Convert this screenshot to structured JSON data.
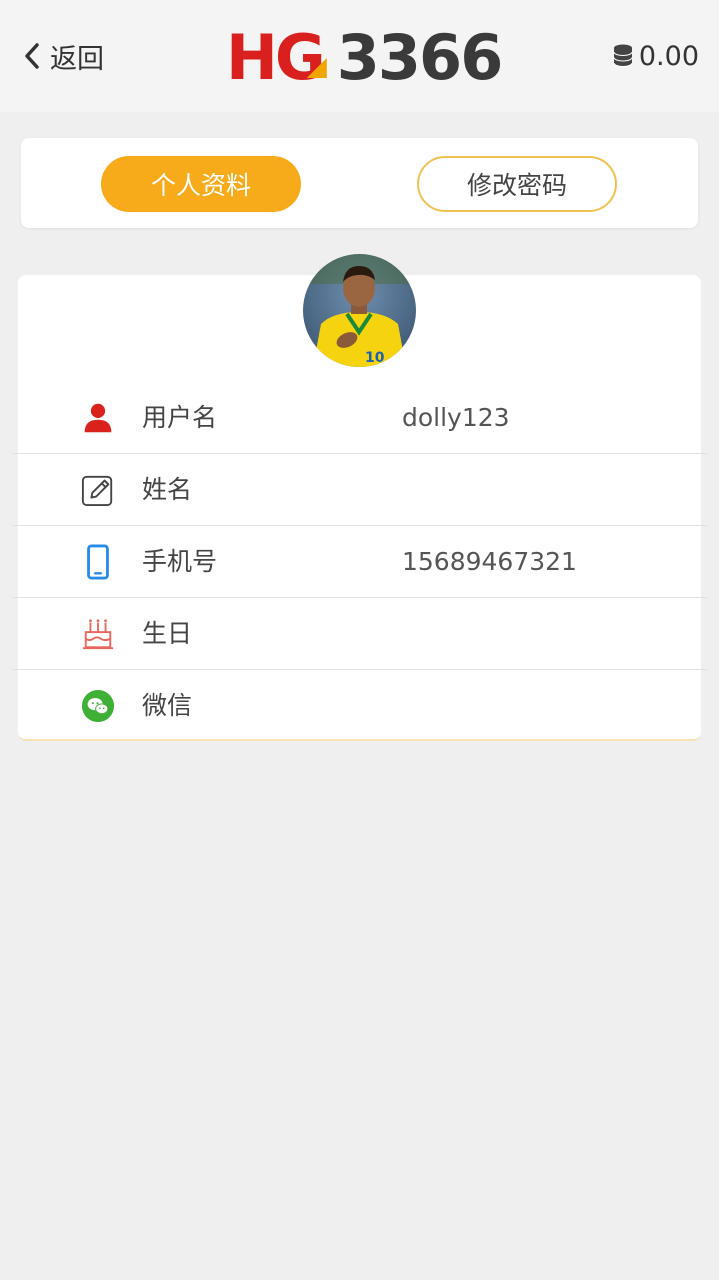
{
  "header": {
    "back_label": "返回",
    "logo_left": "HG",
    "logo_right": "3366",
    "balance": "0.00"
  },
  "tabs": [
    {
      "label": "个人资料",
      "active": true
    },
    {
      "label": "修改密码",
      "active": false
    }
  ],
  "profile": {
    "avatar": "user-avatar-photo",
    "rows": [
      {
        "icon": "user-icon",
        "label": "用户名",
        "value": "dolly123"
      },
      {
        "icon": "edit-icon",
        "label": "姓名",
        "value": ""
      },
      {
        "icon": "phone-icon",
        "label": "手机号",
        "value": "15689467321"
      },
      {
        "icon": "birthday-cake-icon",
        "label": "生日",
        "value": ""
      },
      {
        "icon": "wechat-icon",
        "label": "微信",
        "value": ""
      }
    ]
  },
  "colors": {
    "accent": "#f7aa1a",
    "logo_red": "#d9201e",
    "logo_dark": "#3a3a3a",
    "user_icon": "#d8221b",
    "phone_icon": "#2a8be6",
    "cake_icon": "#e8675d",
    "wechat_icon": "#3eb036"
  }
}
